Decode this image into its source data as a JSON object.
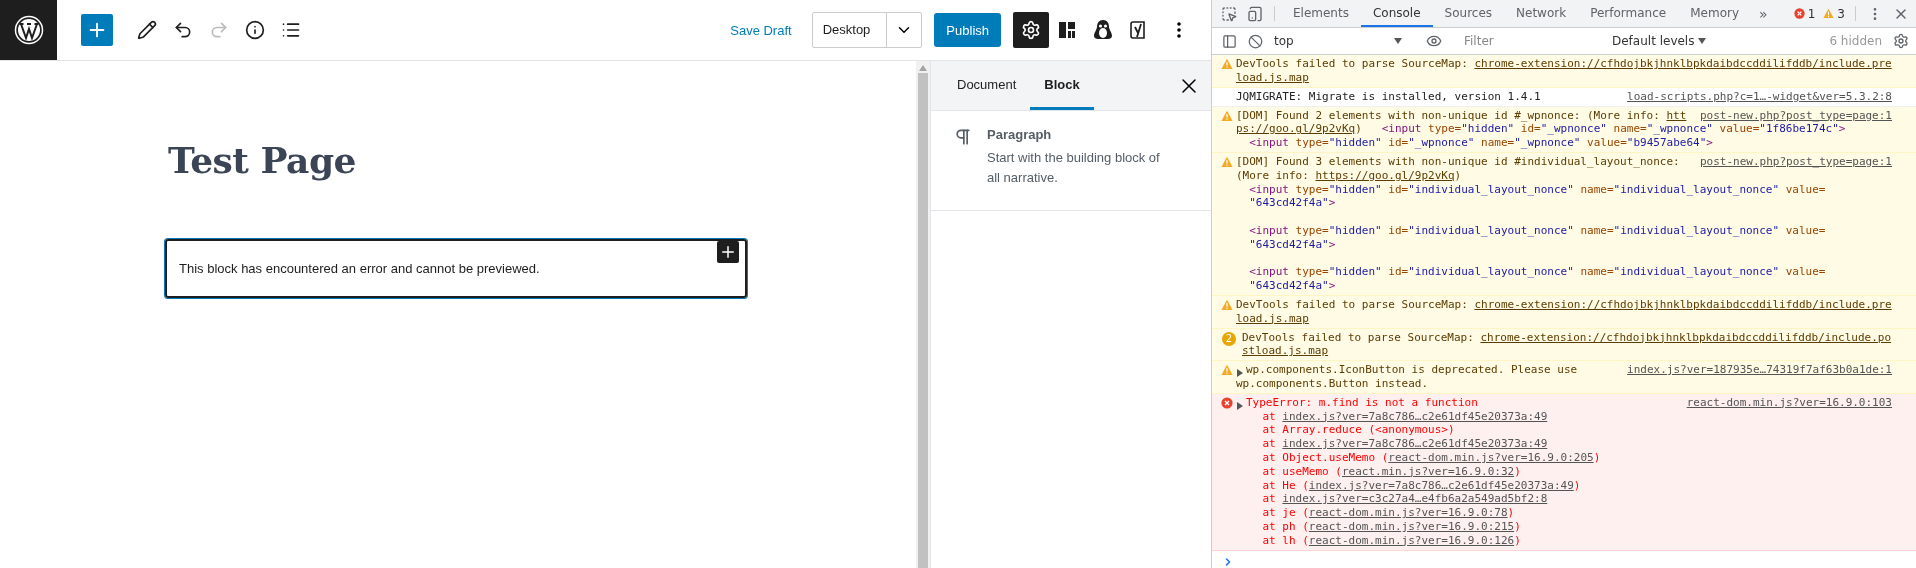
{
  "editor_header": {
    "tools": [
      {
        "kind": "inserter",
        "disabled": false
      },
      {
        "kind": "edit",
        "disabled": false
      },
      {
        "kind": "undo",
        "disabled": false
      },
      {
        "kind": "redo",
        "disabled": true
      },
      {
        "kind": "info",
        "disabled": false
      },
      {
        "kind": "outline",
        "disabled": false
      }
    ],
    "save_draft": "Save Draft",
    "preview_device": "Desktop",
    "publish": "Publish",
    "plugins": [
      {
        "kind": "settings",
        "pressed": true
      },
      {
        "kind": "blocks",
        "pressed": false
      },
      {
        "kind": "penguin",
        "pressed": false
      },
      {
        "kind": "yoast",
        "pressed": false
      }
    ]
  },
  "editor": {
    "title": "Test Page",
    "blocks": [
      {
        "kind": "error",
        "text": "This block has encountered an error and cannot be previewed.",
        "selected": true
      }
    ]
  },
  "sidebar": {
    "tabs": [
      {
        "label": "Document",
        "selected": false
      },
      {
        "label": "Block",
        "selected": true
      }
    ],
    "block_card": {
      "title": "Paragraph",
      "description": "Start with the building block of all narrative."
    }
  },
  "devtools": {
    "tabs": [
      {
        "label": "Elements",
        "selected": false
      },
      {
        "label": "Console",
        "selected": true
      },
      {
        "label": "Sources",
        "selected": false
      },
      {
        "label": "Network",
        "selected": false
      },
      {
        "label": "Performance",
        "selected": false
      },
      {
        "label": "Memory",
        "selected": false
      }
    ],
    "more_tabs": "»",
    "error_count": "1",
    "warning_count": "3",
    "context": "top",
    "filter_placeholder": "Filter",
    "levels": "Default levels",
    "hidden": "6 hidden",
    "messages": [
      {
        "kind": "warning",
        "expandable": false,
        "lines": [
          {
            "spaced": false,
            "segments": [
              {
                "kind": "text",
                "t": "DevTools failed to parse SourceMap: "
              },
              {
                "kind": "link",
                "t": "chrome-extension://cfhdojbkjhnklbpkdaibdccddilifddb/include.pre"
              }
            ]
          },
          {
            "spaced": false,
            "segments": [
              {
                "kind": "link",
                "t": "load.js.map"
              }
            ]
          }
        ]
      },
      {
        "kind": "info",
        "expandable": false,
        "source": "load-scripts.php?c=1…-widget&ver=5.3.2:8",
        "lines": [
          {
            "spaced": false,
            "segments": [
              {
                "kind": "text",
                "t": "JQMIGRATE: Migrate is installed, version 1.4.1"
              }
            ]
          }
        ]
      },
      {
        "kind": "warning",
        "expandable": false,
        "source": "post-new.php?post_type=page:1",
        "lines": [
          {
            "spaced": false,
            "segments": [
              {
                "kind": "text",
                "t": "[DOM] Found 2 elements with non-unique id #_wpnonce: (More info: "
              },
              {
                "kind": "link",
                "t": "htt"
              }
            ]
          },
          {
            "spaced": false,
            "segments": [
              {
                "kind": "link",
                "t": "ps://goo.gl/9p2vKq"
              },
              {
                "kind": "text",
                "t": ")   "
              },
              {
                "kind": "tag",
                "t": "<input"
              },
              {
                "kind": "attr",
                "t": " type="
              },
              {
                "kind": "value",
                "t": "\"hidden\""
              },
              {
                "kind": "attr",
                "t": " id="
              },
              {
                "kind": "value",
                "t": "\"_wpnonce\""
              },
              {
                "kind": "attr",
                "t": " name="
              },
              {
                "kind": "value",
                "t": "\"_wpnonce\""
              },
              {
                "kind": "attr",
                "t": " value="
              },
              {
                "kind": "value",
                "t": "\"1f86be174c\""
              },
              {
                "kind": "tag",
                "t": ">"
              }
            ]
          },
          {
            "spaced": false,
            "segments": [
              {
                "kind": "tag",
                "t": "  <input"
              },
              {
                "kind": "attr",
                "t": " type="
              },
              {
                "kind": "value",
                "t": "\"hidden\""
              },
              {
                "kind": "attr",
                "t": " id="
              },
              {
                "kind": "value",
                "t": "\"_wpnonce\""
              },
              {
                "kind": "attr",
                "t": " name="
              },
              {
                "kind": "value",
                "t": "\"_wpnonce\""
              },
              {
                "kind": "attr",
                "t": " value="
              },
              {
                "kind": "value",
                "t": "\"b9457abe64\""
              },
              {
                "kind": "tag",
                "t": ">"
              }
            ]
          }
        ]
      },
      {
        "kind": "warning",
        "expandable": false,
        "source": "post-new.php?post_type=page:1",
        "lines": [
          {
            "spaced": false,
            "segments": [
              {
                "kind": "text",
                "t": "[DOM] Found 3 elements with non-unique id #individual_layout_nonce:"
              }
            ]
          },
          {
            "spaced": false,
            "segments": [
              {
                "kind": "text",
                "t": "(More info: "
              },
              {
                "kind": "link",
                "t": "https://goo.gl/9p2vKq"
              },
              {
                "kind": "text",
                "t": ")"
              }
            ]
          },
          {
            "spaced": false,
            "segments": [
              {
                "kind": "tag",
                "t": "  <input"
              },
              {
                "kind": "attr",
                "t": " type="
              },
              {
                "kind": "value",
                "t": "\"hidden\""
              },
              {
                "kind": "attr",
                "t": " id="
              },
              {
                "kind": "value",
                "t": "\"individual_layout_nonce\""
              },
              {
                "kind": "attr",
                "t": " name="
              },
              {
                "kind": "value",
                "t": "\"individual_layout_nonce\""
              },
              {
                "kind": "attr",
                "t": " value="
              }
            ]
          },
          {
            "spaced": false,
            "segments": [
              {
                "kind": "value",
                "t": "  \"643cd42f4a\""
              },
              {
                "kind": "tag",
                "t": ">"
              }
            ]
          },
          {
            "spaced": true,
            "segments": [
              {
                "kind": "tag",
                "t": "  <input"
              },
              {
                "kind": "attr",
                "t": " type="
              },
              {
                "kind": "value",
                "t": "\"hidden\""
              },
              {
                "kind": "attr",
                "t": " id="
              },
              {
                "kind": "value",
                "t": "\"individual_layout_nonce\""
              },
              {
                "kind": "attr",
                "t": " name="
              },
              {
                "kind": "value",
                "t": "\"individual_layout_nonce\""
              },
              {
                "kind": "attr",
                "t": " value="
              }
            ]
          },
          {
            "spaced": false,
            "segments": [
              {
                "kind": "value",
                "t": "  \"643cd42f4a\""
              },
              {
                "kind": "tag",
                "t": ">"
              }
            ]
          },
          {
            "spaced": true,
            "segments": [
              {
                "kind": "tag",
                "t": "  <input"
              },
              {
                "kind": "attr",
                "t": " type="
              },
              {
                "kind": "value",
                "t": "\"hidden\""
              },
              {
                "kind": "attr",
                "t": " id="
              },
              {
                "kind": "value",
                "t": "\"individual_layout_nonce\""
              },
              {
                "kind": "attr",
                "t": " name="
              },
              {
                "kind": "value",
                "t": "\"individual_layout_nonce\""
              },
              {
                "kind": "attr",
                "t": " value="
              }
            ]
          },
          {
            "spaced": false,
            "segments": [
              {
                "kind": "value",
                "t": "  \"643cd42f4a\""
              },
              {
                "kind": "tag",
                "t": ">"
              }
            ]
          }
        ]
      },
      {
        "kind": "warning",
        "expandable": false,
        "lines": [
          {
            "spaced": false,
            "segments": [
              {
                "kind": "text",
                "t": "DevTools failed to parse SourceMap: "
              },
              {
                "kind": "link",
                "t": "chrome-extension://cfhdojbkjhnklbpkdaibdccddilifddb/include.pre"
              }
            ]
          },
          {
            "spaced": false,
            "segments": [
              {
                "kind": "link",
                "t": "load.js.map"
              }
            ]
          }
        ]
      },
      {
        "kind": "warning",
        "count": "2",
        "expandable": false,
        "lines": [
          {
            "spaced": false,
            "segments": [
              {
                "kind": "text",
                "t": "DevTools failed to parse SourceMap: "
              },
              {
                "kind": "link",
                "t": "chrome-extension://cfhdojbkjhnklbpkdaibdccddilifddb/include.po"
              }
            ]
          },
          {
            "spaced": false,
            "segments": [
              {
                "kind": "link",
                "t": "stload.js.map"
              }
            ]
          }
        ]
      },
      {
        "kind": "warning",
        "expandable": true,
        "source": "index.js?ver=187935e…74319f7af63b0a1de:1",
        "lines": [
          {
            "spaced": false,
            "segments": [
              {
                "kind": "text",
                "t": "wp.components.IconButton is deprecated. Please use"
              }
            ]
          },
          {
            "spaced": false,
            "segments": [
              {
                "kind": "text",
                "t": "wp.components.Button instead."
              }
            ]
          }
        ]
      },
      {
        "kind": "error",
        "expandable": true,
        "source": "react-dom.min.js?ver=16.9.0:103",
        "lines": [
          {
            "spaced": false,
            "segments": [
              {
                "kind": "text",
                "t": "TypeError: m.find is not a function"
              }
            ]
          },
          {
            "spaced": false,
            "segments": [
              {
                "kind": "text",
                "t": "    at "
              },
              {
                "kind": "link",
                "t": "index.js?ver=7a8c786…c2e61df45e20373a:49"
              }
            ]
          },
          {
            "spaced": false,
            "segments": [
              {
                "kind": "text",
                "t": "    at Array.reduce (<anonymous>)"
              }
            ]
          },
          {
            "spaced": false,
            "segments": [
              {
                "kind": "text",
                "t": "    at "
              },
              {
                "kind": "link",
                "t": "index.js?ver=7a8c786…c2e61df45e20373a:49"
              }
            ]
          },
          {
            "spaced": false,
            "segments": [
              {
                "kind": "text",
                "t": "    at Object.useMemo ("
              },
              {
                "kind": "link",
                "t": "react-dom.min.js?ver=16.9.0:205"
              },
              {
                "kind": "text",
                "t": ")"
              }
            ]
          },
          {
            "spaced": false,
            "segments": [
              {
                "kind": "text",
                "t": "    at useMemo ("
              },
              {
                "kind": "link",
                "t": "react.min.js?ver=16.9.0:32"
              },
              {
                "kind": "text",
                "t": ")"
              }
            ]
          },
          {
            "spaced": false,
            "segments": [
              {
                "kind": "text",
                "t": "    at He ("
              },
              {
                "kind": "link",
                "t": "index.js?ver=7a8c786…c2e61df45e20373a:49"
              },
              {
                "kind": "text",
                "t": ")"
              }
            ]
          },
          {
            "spaced": false,
            "segments": [
              {
                "kind": "text",
                "t": "    at "
              },
              {
                "kind": "link",
                "t": "index.js?ver=c3c27a4…e4fb6a2a549ad5bf2:8"
              }
            ]
          },
          {
            "spaced": false,
            "segments": [
              {
                "kind": "text",
                "t": "    at je ("
              },
              {
                "kind": "link",
                "t": "react-dom.min.js?ver=16.9.0:78"
              },
              {
                "kind": "text",
                "t": ")"
              }
            ]
          },
          {
            "spaced": false,
            "segments": [
              {
                "kind": "text",
                "t": "    at ph ("
              },
              {
                "kind": "link",
                "t": "react-dom.min.js?ver=16.9.0:215"
              },
              {
                "kind": "text",
                "t": ")"
              }
            ]
          },
          {
            "spaced": false,
            "segments": [
              {
                "kind": "text",
                "t": "    at lh ("
              },
              {
                "kind": "link",
                "t": "react-dom.min.js?ver=16.9.0:126"
              },
              {
                "kind": "text",
                "t": ")"
              }
            ]
          }
        ]
      }
    ]
  }
}
